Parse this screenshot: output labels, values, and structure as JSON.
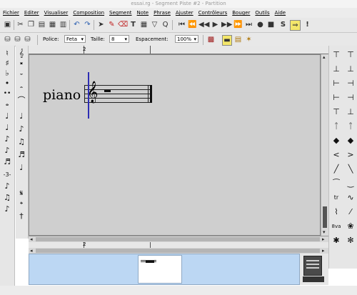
{
  "window": {
    "title": "essai.rg - Segment Piste #2 - Partition"
  },
  "menu": {
    "items": [
      "Fichier",
      "Editer",
      "Visualiser",
      "Composition",
      "Segment",
      "Note",
      "Phrase",
      "Ajuster",
      "Contrôleurs",
      "Bouger",
      "Outils",
      "Aide"
    ]
  },
  "toolbar2": {
    "font_label": "Police:",
    "font_value": "Feta",
    "size_label": "Taille:",
    "size_value": "8",
    "spacing_label": "Espacement:",
    "spacing_value": "100%"
  },
  "ruler": {
    "bar_number": "2"
  },
  "ruler_bottom": {
    "bar_number": "2"
  },
  "staff": {
    "instrument_name": "piano"
  },
  "colors": {
    "canvas": "#cfcfcf",
    "panner": "#bcd7f3",
    "cursor": "#2d2db4"
  }
}
